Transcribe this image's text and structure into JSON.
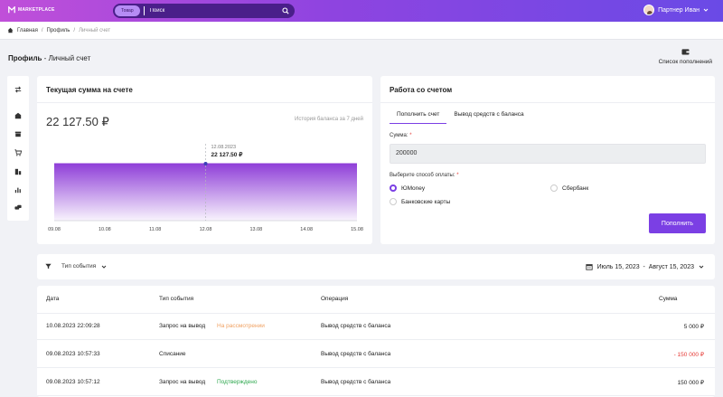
{
  "header": {
    "logo_text": "MARKETPLACE",
    "search_category": "Товар",
    "search_placeholder": "Поиск",
    "user_name": "Партнер Иван"
  },
  "breadcrumb": [
    "Главная",
    "Профиль",
    "Личный счет"
  ],
  "page": {
    "title_bold": "Профиль",
    "title_rest": " - Личный счет",
    "refill_list_label": "Список пополнений"
  },
  "balance_card": {
    "title": "Текущая сумма на счете",
    "amount": "22 127.50 ₽",
    "history_label": "История баланса за 7 дней",
    "tooltip_date": "12.08.2023",
    "tooltip_value": "22 127.50 ₽"
  },
  "chart_data": {
    "type": "area",
    "x": [
      "09.08",
      "10.08",
      "11.08",
      "12.08",
      "13.08",
      "14.08",
      "15.08"
    ],
    "values": [
      22127.5,
      22127.5,
      22127.5,
      22127.5,
      22127.5,
      22127.5,
      22127.5
    ],
    "highlight": {
      "x": "12.08",
      "date": "12.08.2023",
      "value": "22 127.50 ₽"
    },
    "color": "#8f3fd8"
  },
  "account_card": {
    "title": "Работа со счетом",
    "tabs": [
      "Пополнить счет",
      "Вывод средств с баланса"
    ],
    "amount_label": "Сумма:",
    "amount_value": "200000",
    "method_label": "Выберите способ оплаты:",
    "methods": [
      "ЮMoney",
      "Сбербанк",
      "Банковские карты"
    ],
    "submit_label": "Пополнить",
    "accent": "#7b3fe4"
  },
  "filter": {
    "event_type_label": "Тип события",
    "date_range": "Июль 15, 2023  -  Август 15, 2023"
  },
  "table": {
    "headers": [
      "Дата",
      "Тип события",
      "Операция",
      "Сумма"
    ],
    "rows": [
      {
        "date": "10.08.2023 22:09:28",
        "type": "Запрос на вывод",
        "status": "На рассмотрении",
        "operation": "Вывод средств с баланса",
        "amount": "5 000 ₽"
      },
      {
        "date": "09.08.2023 10:57:33",
        "type": "Списание",
        "status": "",
        "operation": "Вывод средств с баланса",
        "amount": "- 150 000 ₽"
      },
      {
        "date": "09.08.2023 10:57:12",
        "type": "Запрос на вывод",
        "status": "Подтверждено",
        "operation": "Вывод средств с баланса",
        "amount": "150 000 ₽"
      }
    ],
    "colors": {
      "pending": "#f0a060",
      "approved": "#2fa84f",
      "negative": "#e53935"
    }
  }
}
